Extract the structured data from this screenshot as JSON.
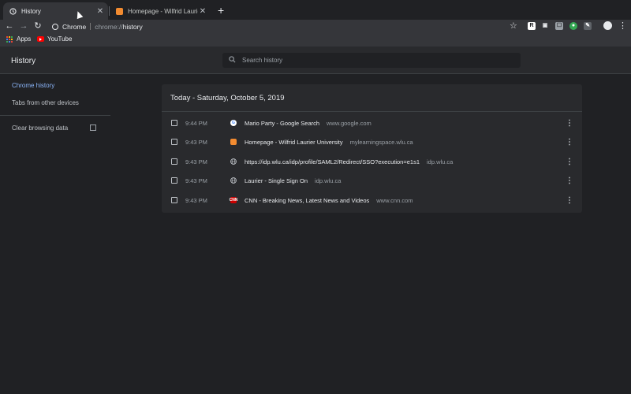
{
  "tabs": [
    {
      "title": "History",
      "icon": "history-icon",
      "active": true
    },
    {
      "title": "Homepage - Wilfrid Laurier Uni",
      "icon": "laurier-favicon-icon",
      "active": false
    }
  ],
  "toolbar": {
    "omnibox_site": "Chrome",
    "omnibox_scheme": "chrome://",
    "omnibox_path": "history"
  },
  "extensions": [
    {
      "label": "R",
      "bg": "#ffffff",
      "fg": "#202124"
    },
    {
      "label": "▣",
      "bg": "#35363a",
      "fg": "#e8eaed"
    },
    {
      "label": "☐",
      "bg": "#9aa0a6",
      "fg": "#35363a"
    },
    {
      "label": "●",
      "bg": "#34a853",
      "fg": "#ffffff"
    },
    {
      "label": "✎",
      "bg": "#5f6368",
      "fg": "#ffffff"
    }
  ],
  "bookmarks": {
    "apps": "Apps",
    "youtube": "YouTube"
  },
  "page": {
    "title": "History",
    "search_placeholder": "Search history"
  },
  "sidebar": {
    "items": [
      {
        "label": "Chrome history"
      },
      {
        "label": "Tabs from other devices"
      },
      {
        "label": "Clear browsing data"
      }
    ]
  },
  "history": {
    "header": "Today - Saturday, October 5, 2019",
    "entries": [
      {
        "time": "9:44 PM",
        "title": "Mario Party - Google Search",
        "domain": "www.google.com",
        "icon": "google-favicon-icon"
      },
      {
        "time": "9:43 PM",
        "title": "Homepage - Wilfrid Laurier University",
        "domain": "mylearningspace.wlu.ca",
        "icon": "laurier-favicon-icon"
      },
      {
        "time": "9:43 PM",
        "title": "https://idp.wlu.ca/idp/profile/SAML2/Redirect/SSO?execution=e1s1",
        "domain": "idp.wlu.ca",
        "icon": "globe-icon"
      },
      {
        "time": "9:43 PM",
        "title": "Laurier - Single Sign On",
        "domain": "idp.wlu.ca",
        "icon": "globe-icon"
      },
      {
        "time": "9:43 PM",
        "title": "CNN - Breaking News, Latest News and Videos",
        "domain": "www.cnn.com",
        "icon": "cnn-favicon-icon"
      }
    ]
  },
  "colors": {
    "accent": "#8ab4f8",
    "background": "#202124",
    "card": "#292a2d"
  }
}
